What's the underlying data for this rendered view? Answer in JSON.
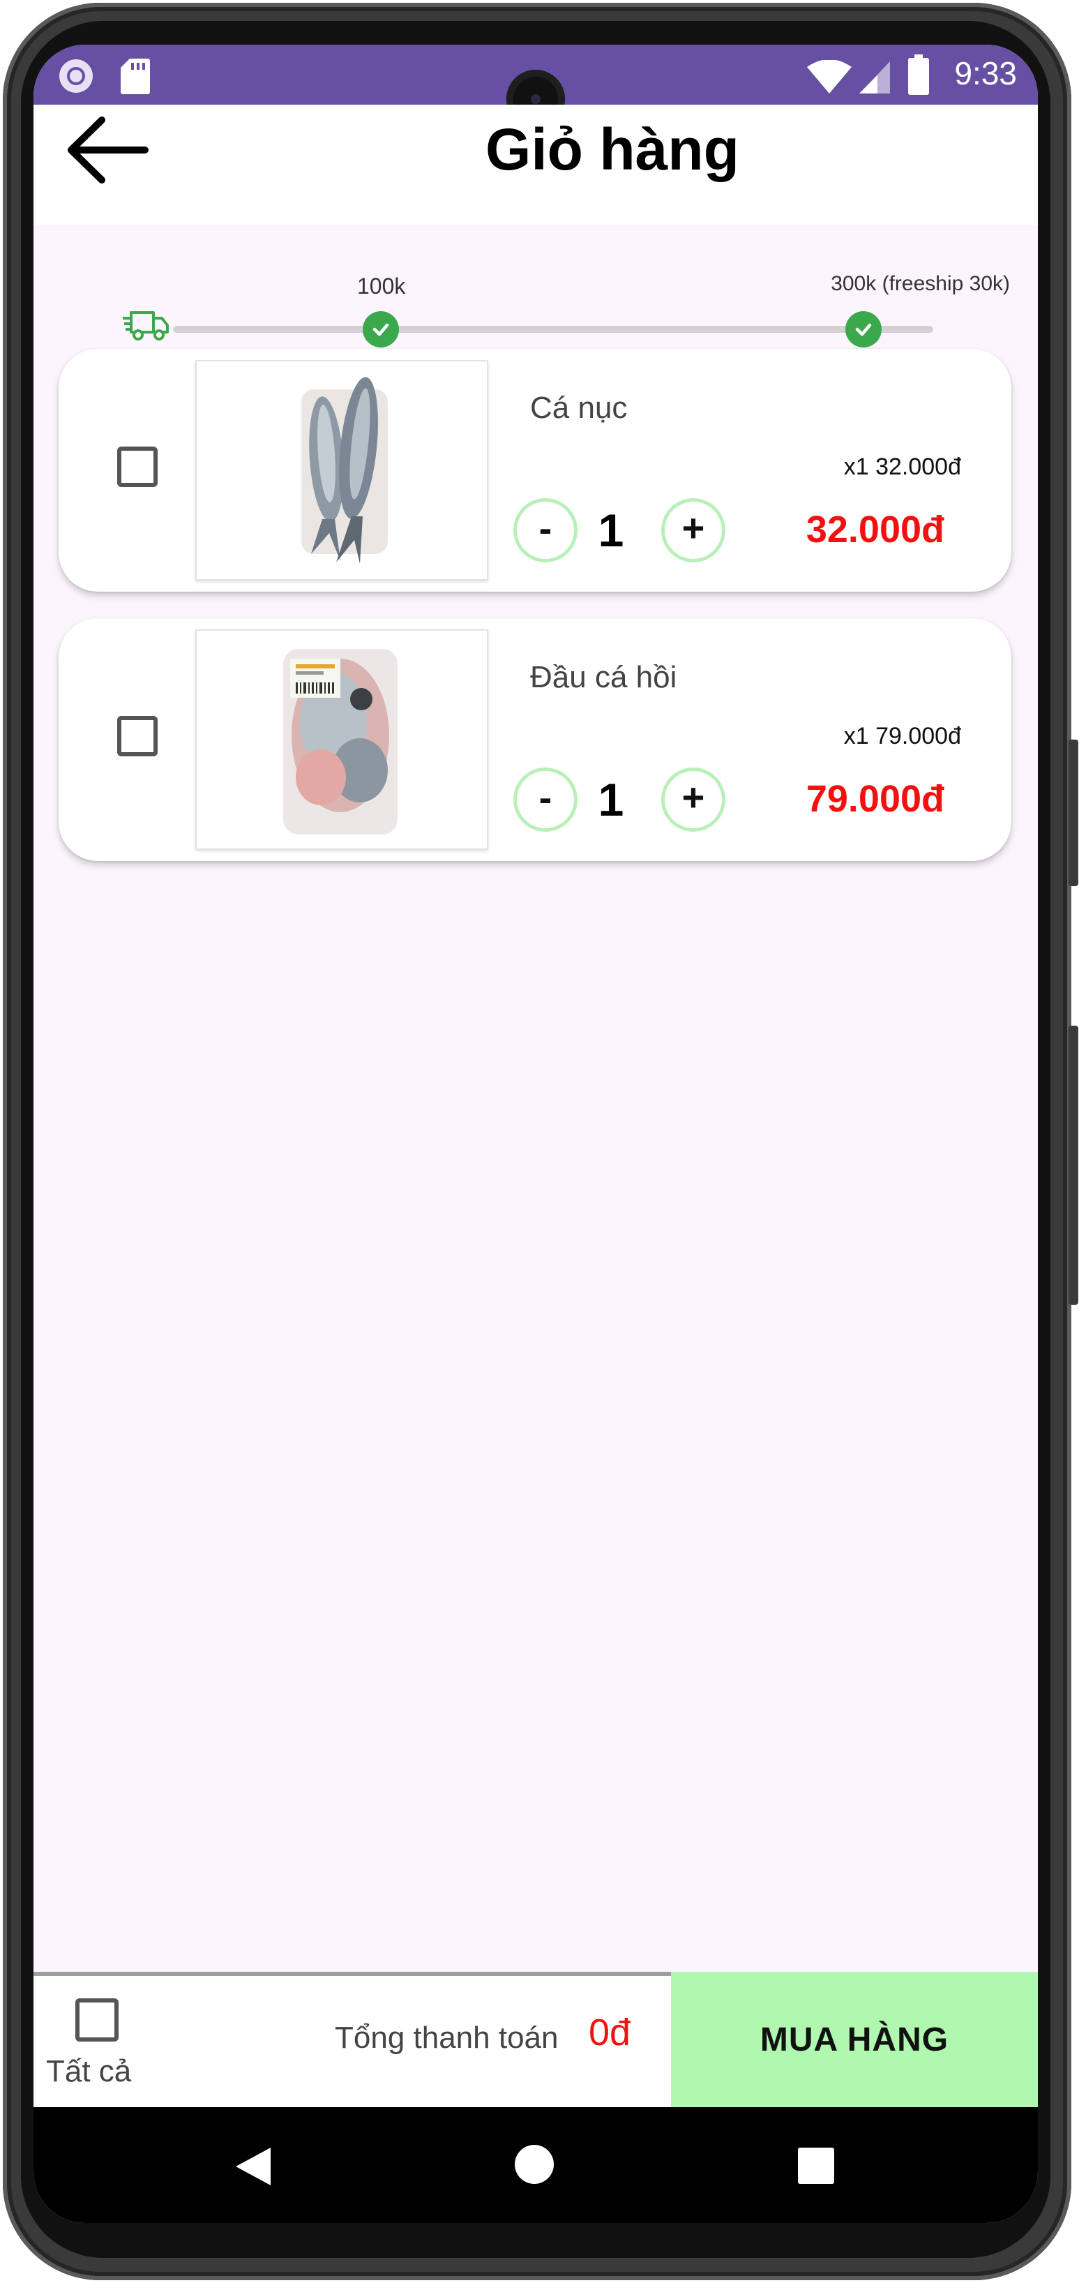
{
  "status_bar": {
    "time": "9:33",
    "icons": [
      "circle-notification-icon",
      "sd-card-icon",
      "wifi-icon",
      "cell-signal-icon",
      "battery-icon"
    ],
    "background_color": "#6750a4"
  },
  "header": {
    "title": "Giỏ hàng",
    "back_icon": "arrow-left-icon"
  },
  "shipping_progress": {
    "icon": "delivery-truck-icon",
    "milestones": [
      {
        "label": "100k",
        "reached": true
      },
      {
        "label": "300k (freeship 30k)",
        "reached": true
      }
    ],
    "accent_color": "#3aa94b"
  },
  "cart_items": [
    {
      "name": "Cá nục",
      "unit_line": "x1 32.000đ",
      "quantity": "1",
      "minus_label": "-",
      "plus_label": "+",
      "total_price": "32.000đ",
      "checked": false,
      "image_icon": "mackerel-fish-image"
    },
    {
      "name": "Đầu cá hồi",
      "unit_line": "x1 79.000đ",
      "quantity": "1",
      "minus_label": "-",
      "plus_label": "+",
      "total_price": "79.000đ",
      "checked": false,
      "image_icon": "salmon-head-image"
    }
  ],
  "footer": {
    "select_all_label": "Tất cả",
    "total_label": "Tổng thanh toán",
    "total_value": "0đ",
    "buy_button_label": "MUA HÀNG",
    "buy_button_color": "#b0f7b0",
    "price_color": "#f41010"
  },
  "nav_bar": {
    "icons": [
      "nav-back-icon",
      "nav-home-icon",
      "nav-recents-icon"
    ]
  }
}
